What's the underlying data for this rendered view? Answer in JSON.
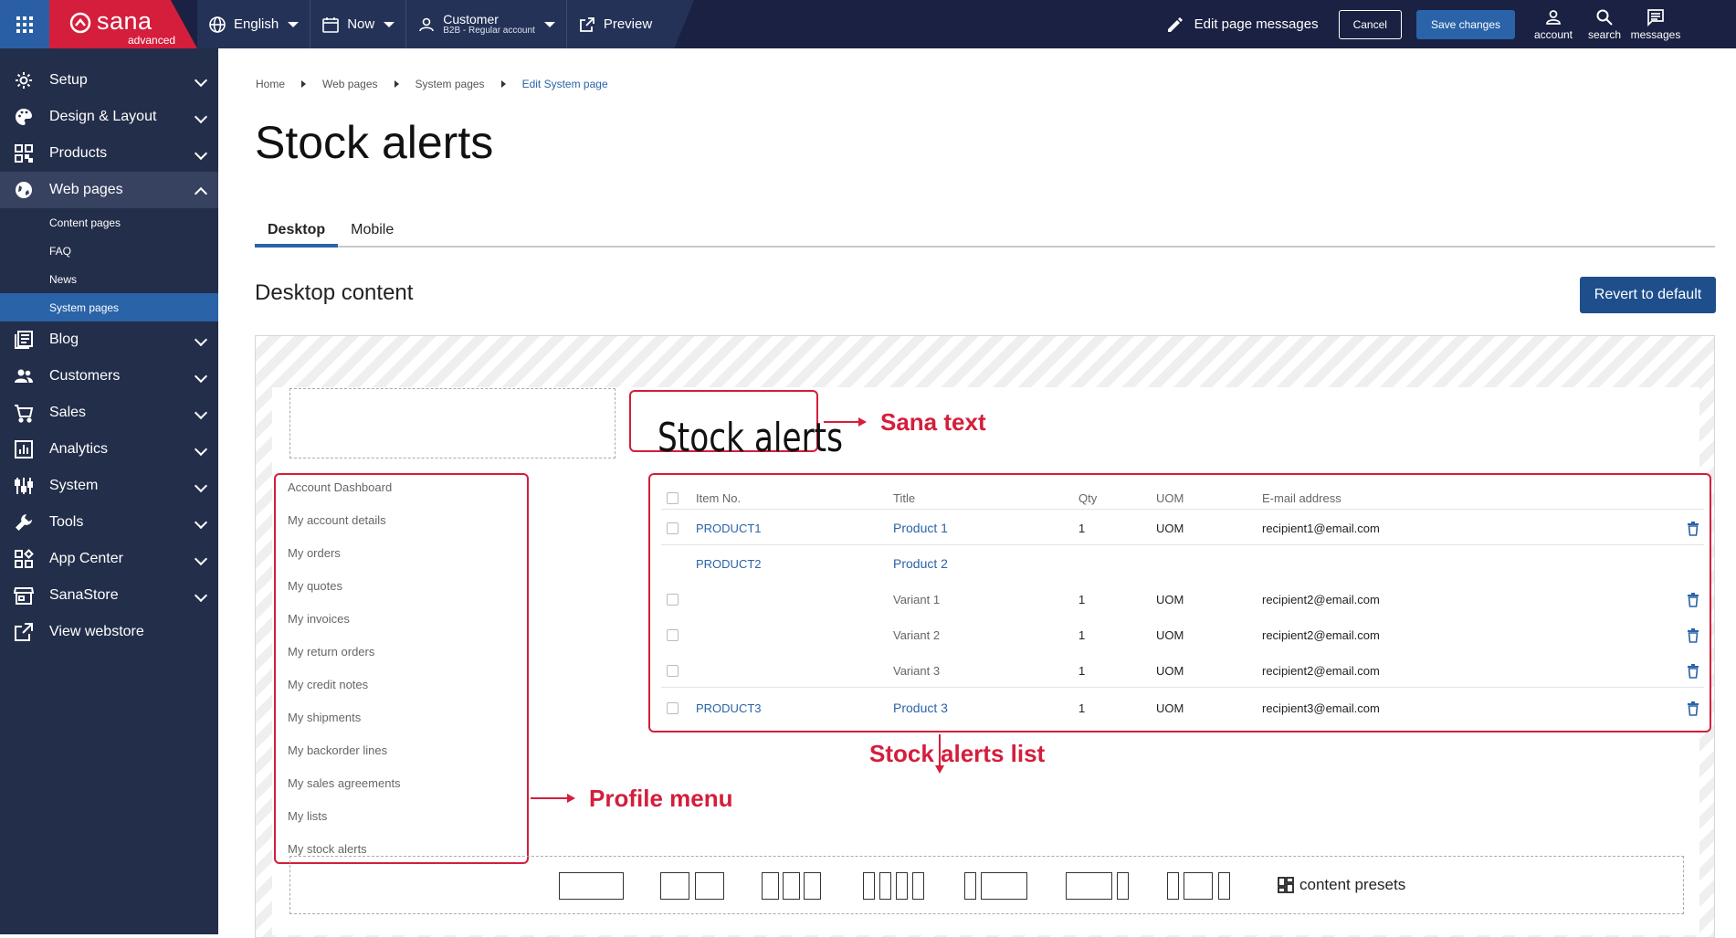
{
  "topbar": {
    "brand_name": "sana",
    "brand_sub": "advanced",
    "language": "English",
    "time": "Now",
    "customer_title": "Customer",
    "customer_sub": "B2B - Regular account",
    "preview": "Preview",
    "edit_messages": "Edit page messages",
    "cancel": "Cancel",
    "save": "Save changes",
    "account": "account",
    "search": "search",
    "messages": "messages"
  },
  "sidebar": {
    "items": [
      {
        "label": "Setup",
        "icon": "gear-icon"
      },
      {
        "label": "Design & Layout",
        "icon": "palette-icon"
      },
      {
        "label": "Products",
        "icon": "qr-icon"
      },
      {
        "label": "Web pages",
        "icon": "globe-icon"
      },
      {
        "label": "Blog",
        "icon": "blog-icon"
      },
      {
        "label": "Customers",
        "icon": "people-icon"
      },
      {
        "label": "Sales",
        "icon": "cart-icon"
      },
      {
        "label": "Analytics",
        "icon": "chart-icon"
      },
      {
        "label": "System",
        "icon": "system-icon"
      },
      {
        "label": "Tools",
        "icon": "wrench-icon"
      },
      {
        "label": "App Center",
        "icon": "apps-icon"
      },
      {
        "label": "SanaStore",
        "icon": "store-icon"
      },
      {
        "label": "View webstore",
        "icon": "external-link-icon"
      }
    ],
    "web_pages_sub": [
      "Content pages",
      "FAQ",
      "News",
      "System pages"
    ]
  },
  "breadcrumb": [
    "Home",
    "Web pages",
    "System pages",
    "Edit System page"
  ],
  "page_title": "Stock alerts",
  "tabs": [
    "Desktop",
    "Mobile"
  ],
  "section_title": "Desktop content",
  "revert_button": "Revert to default",
  "canvas": {
    "stock_heading": "Stock alerts",
    "sana_text_label": "Sana text",
    "stock_alerts_list_label": "Stock alerts list",
    "profile_menu_label": "Profile menu",
    "profile_menu": [
      "Account Dashboard",
      "My account details",
      "My orders",
      "My quotes",
      "My invoices",
      "My return orders",
      "My credit notes",
      "My shipments",
      "My backorder lines",
      "My sales agreements",
      "My lists",
      "My stock alerts"
    ],
    "table": {
      "headers": [
        "Item No.",
        "Title",
        "Qty",
        "UOM",
        "E-mail address"
      ],
      "rows": [
        {
          "item": "PRODUCT1",
          "title": "Product 1",
          "qty": "1",
          "uom": "UOM",
          "email": "recipient1@email.com"
        },
        {
          "item": "PRODUCT2",
          "title": "Product 2",
          "qty": "",
          "uom": "",
          "email": ""
        },
        {
          "item": "",
          "title": "Variant 1",
          "qty": "1",
          "uom": "UOM",
          "email": "recipient2@email.com"
        },
        {
          "item": "",
          "title": "Variant 2",
          "qty": "1",
          "uom": "UOM",
          "email": "recipient2@email.com"
        },
        {
          "item": "",
          "title": "Variant 3",
          "qty": "1",
          "uom": "UOM",
          "email": "recipient2@email.com"
        },
        {
          "item": "PRODUCT3",
          "title": "Product 3",
          "qty": "1",
          "uom": "UOM",
          "email": "recipient3@email.com"
        }
      ]
    },
    "presets_label": "content presets"
  },
  "colors": {
    "brand_red": "#d41e3c",
    "nav_dark": "#1b2142",
    "sidebar": "#232e4a",
    "accent_blue": "#2a63a8"
  }
}
